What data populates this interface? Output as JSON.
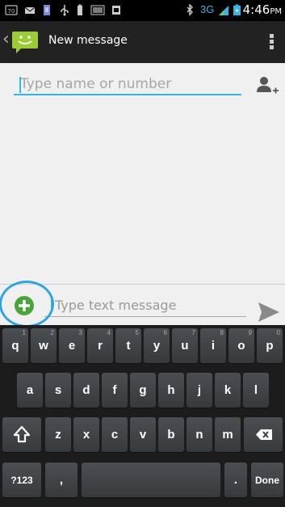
{
  "status_bar": {
    "time": "4:46",
    "ampm": "PM",
    "network": "3G",
    "icons": [
      "notification-70-icon",
      "email-icon",
      "sd-card-icon",
      "usb-icon",
      "battery-small-icon",
      "barcode-icon",
      "sim-icon",
      "bluetooth-icon",
      "signal-icon",
      "battery-icon"
    ]
  },
  "action_bar": {
    "title": "New message",
    "icons": [
      "back-chevron-icon",
      "messaging-app-icon",
      "overflow-menu-icon"
    ]
  },
  "compose": {
    "recipient_placeholder": "Type name or number",
    "message_placeholder": "Type text message",
    "accent_color": "#33b5e5",
    "highlight_color": "#2aa7e3"
  },
  "keyboard": {
    "row1": [
      {
        "key": "q",
        "hint": "1"
      },
      {
        "key": "w",
        "hint": "2"
      },
      {
        "key": "e",
        "hint": "3"
      },
      {
        "key": "r",
        "hint": "4"
      },
      {
        "key": "t",
        "hint": "5"
      },
      {
        "key": "y",
        "hint": "6"
      },
      {
        "key": "u",
        "hint": "7"
      },
      {
        "key": "i",
        "hint": "8"
      },
      {
        "key": "o",
        "hint": "9"
      },
      {
        "key": "p",
        "hint": "0"
      }
    ],
    "row2": [
      "a",
      "s",
      "d",
      "f",
      "g",
      "h",
      "j",
      "k",
      "l"
    ],
    "row3": [
      "z",
      "x",
      "c",
      "v",
      "b",
      "n",
      "m"
    ],
    "symbols_label": "?123",
    "comma_label": ",",
    "period_label": ".",
    "done_label": "Done"
  }
}
